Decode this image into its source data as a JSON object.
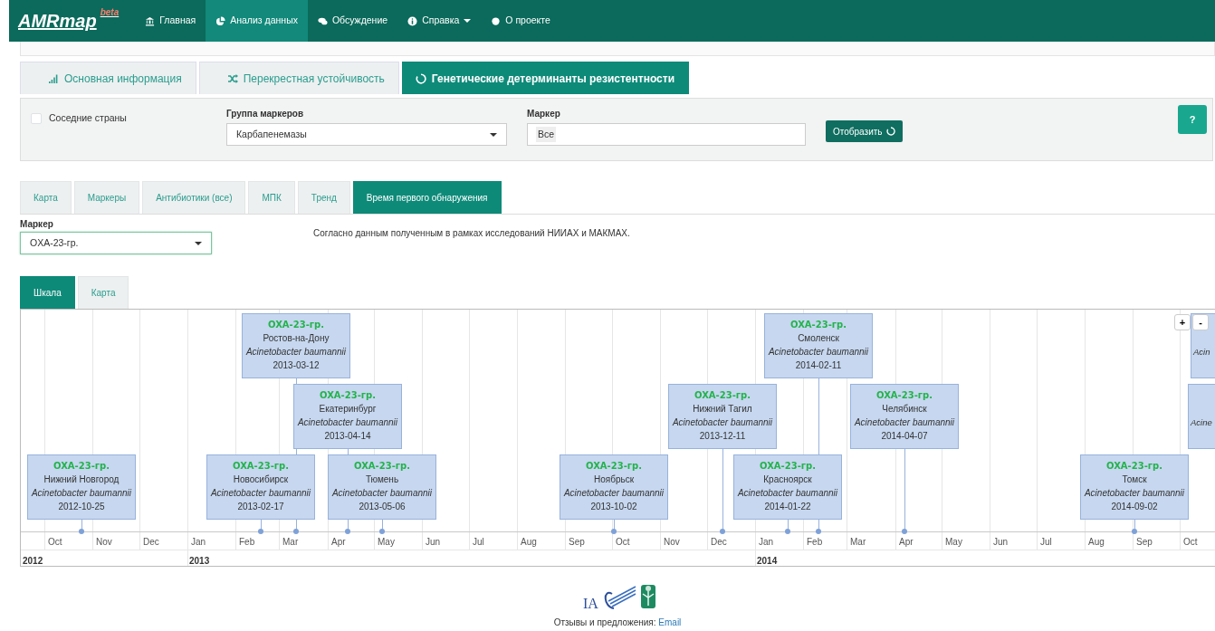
{
  "navbar": {
    "brand": "AMRmap",
    "brand_tag": "beta",
    "items": [
      {
        "label": "Главная",
        "kind": "bank",
        "selected": false,
        "dropdown": false
      },
      {
        "label": "Анализ данных",
        "kind": "pie",
        "selected": true,
        "dropdown": false
      },
      {
        "label": "Обсуждение",
        "kind": "chat",
        "selected": false,
        "dropdown": false
      },
      {
        "label": "Справка",
        "kind": "info",
        "selected": false,
        "dropdown": true
      },
      {
        "label": "О проекте",
        "kind": "dot",
        "selected": false,
        "dropdown": false
      }
    ]
  },
  "main_tabs": [
    {
      "label": "Основная информация",
      "kind": "bars",
      "selected": false
    },
    {
      "label": "Перекрестная устойчивость",
      "kind": "shuffle",
      "selected": false
    },
    {
      "label": "Генетические детерминанты резистентности",
      "kind": "ring",
      "selected": true
    }
  ],
  "filter": {
    "neighbors": {
      "label": "Соседние страны",
      "checked": false
    },
    "group_select": {
      "label": "Группа маркеров",
      "value": "Карбапенемазы"
    },
    "marker_field": {
      "label": "Маркер",
      "value": "Все"
    },
    "show_button": "Отобразить",
    "help_button": "?"
  },
  "sub_tabs": [
    {
      "label": "Карта",
      "selected": false
    },
    {
      "label": "Маркеры",
      "selected": false
    },
    {
      "label": "Антибиотики (все)",
      "selected": false
    },
    {
      "label": "МПК",
      "selected": false
    },
    {
      "label": "Тренд",
      "selected": false
    },
    {
      "label": "Время первого обнаружения",
      "selected": true
    }
  ],
  "marker_select": {
    "label": "Маркер",
    "value": "OXA-23-гр."
  },
  "note": "Согласно данным полученным в рамках исследований НИИАХ и МАКМАХ.",
  "view_tabs": [
    {
      "label": "Шкала",
      "selected": true
    },
    {
      "label": "Карта",
      "selected": false
    }
  ],
  "timeline": {
    "zoom_buttons": [
      "+",
      "-"
    ],
    "items": [
      {
        "marker": "OXA-23-гр.",
        "city": "Нижний Новгород",
        "species": "Acinetobacter baumannii",
        "date": "2012-10-25",
        "kind": "bottom"
      },
      {
        "marker": "OXA-23-гр.",
        "city": "Ростов-на-Дону",
        "species": "Acinetobacter baumannii",
        "date": "2013-03-12",
        "kind": "top"
      },
      {
        "marker": "OXA-23-гр.",
        "city": "Екатеринбург",
        "species": "Acinetobacter baumannii",
        "date": "2013-04-14",
        "kind": "middle"
      },
      {
        "marker": "OXA-23-гр.",
        "city": "Новосибирск",
        "species": "Acinetobacter baumannii",
        "date": "2013-02-17",
        "kind": "bottom"
      },
      {
        "marker": "OXA-23-гр.",
        "city": "Тюмень",
        "species": "Acinetobacter baumannii",
        "date": "2013-05-06",
        "kind": "bottom"
      },
      {
        "marker": "OXA-23-гр.",
        "city": "Ноябрьск",
        "species": "Acinetobacter baumannii",
        "date": "2013-10-02",
        "kind": "bottom"
      },
      {
        "marker": "OXA-23-гр.",
        "city": "Нижний Тагил",
        "species": "Acinetobacter baumannii",
        "date": "2013-12-11",
        "kind": "middle"
      },
      {
        "marker": "OXA-23-гр.",
        "city": "Смоленск",
        "species": "Acinetobacter baumannii",
        "date": "2014-02-11",
        "kind": "top"
      },
      {
        "marker": "OXA-23-гр.",
        "city": "Красноярск",
        "species": "Acinetobacter baumannii",
        "date": "2014-01-22",
        "kind": "bottom"
      },
      {
        "marker": "OXA-23-гр.",
        "city": "Челябинск",
        "species": "Acinetobacter baumannii",
        "date": "2014-04-07",
        "kind": "middle"
      },
      {
        "marker": "OXA-23-гр.",
        "city": "Томск",
        "species": "Acinetobacter baumannii",
        "date": "2014-09-02",
        "kind": "bottom"
      }
    ],
    "edge_items": [
      {
        "species": "Acin",
        "kind": "top"
      },
      {
        "species": "Acine",
        "kind": "middle"
      }
    ],
    "months": [
      "Oct",
      "Nov",
      "Dec",
      "Jan",
      "Feb",
      "Mar",
      "Apr",
      "May",
      "Jun",
      "Jul",
      "Aug",
      "Sep",
      "Oct",
      "Nov",
      "Dec",
      "Jan",
      "Feb",
      "Mar",
      "Apr",
      "May",
      "Jun",
      "Jul",
      "Aug",
      "Sep",
      "Oct"
    ],
    "years": [
      "2012",
      "2013",
      "2014"
    ]
  },
  "footer": {
    "logo_text": "IA",
    "text": "Отзывы и предложения:",
    "link": "Email"
  }
}
